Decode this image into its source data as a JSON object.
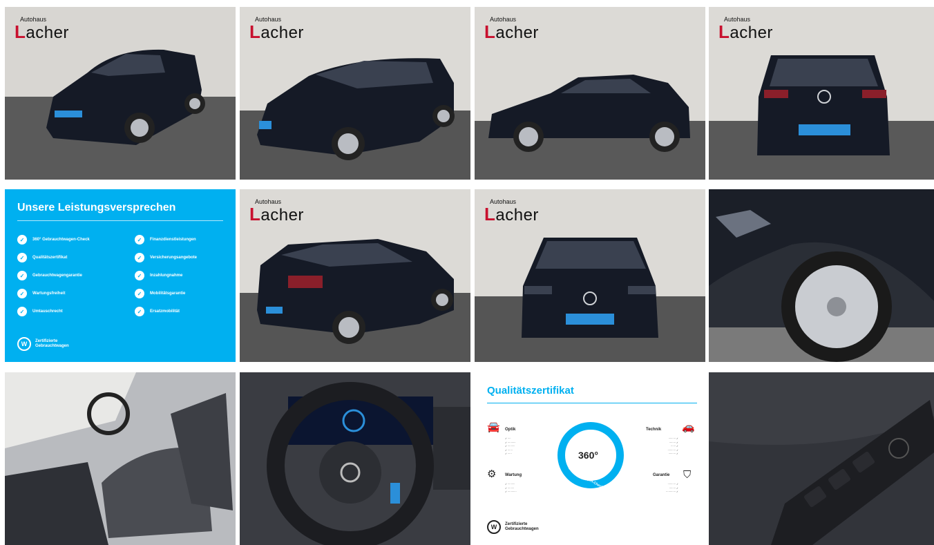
{
  "dealer_logo": {
    "small": "Autohaus",
    "big_first": "L",
    "big_rest": "acher"
  },
  "promise": {
    "title": "Unsere Leistungsversprechen",
    "left_items": [
      "360° Gebrauchtwagen-Check",
      "Qualitätszertifikat",
      "Gebrauchtwagengarantie",
      "Wartungsfreiheit",
      "Umtauschrecht"
    ],
    "right_items": [
      "Finanzdienstleistungen",
      "Versicherungsangebote",
      "Inzahlungnahme",
      "Mobilitätsgarantie",
      "Ersatzmobilität"
    ],
    "brand_line1": "Zertifizierte",
    "brand_line2": "Gebrauchtwagen"
  },
  "quality": {
    "title": "Qualitätszertifikat",
    "center_number": "360°",
    "center_sub": "Gebrauchtwagen-Check",
    "sections": {
      "optik": "Optik",
      "technik": "Technik",
      "wartung": "Wartung",
      "garantie": "Garantie"
    },
    "brand_line1": "Zertifizierte",
    "brand_line2": "Gebrauchtwagen"
  },
  "colors": {
    "accent": "#00b0f0",
    "car": "#151a26",
    "brand_red": "#c8102e"
  },
  "icons": {
    "vw": "vw-logo-icon"
  }
}
